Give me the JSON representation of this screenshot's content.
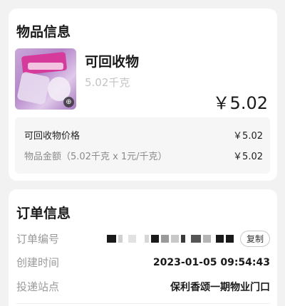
{
  "goods": {
    "title": "物品信息",
    "item_name": "可回收物",
    "item_weight": "5.02千克",
    "item_price": "￥5.02",
    "summary": [
      {
        "label": "可回收物价格",
        "value": "￥5.02"
      },
      {
        "label": "物品金额（5.02千克 x 1元/千克）",
        "value": "￥5.02"
      }
    ]
  },
  "order": {
    "title": "订单信息",
    "order_no_label": "订单编号",
    "copy_label": "复制",
    "created_label": "创建时间",
    "created_value": "2023-01-05 09:54:43",
    "station_label": "投递站点",
    "station_value": "保利香颂一期物业门口"
  },
  "icons": {
    "zoom": "zoom-icon"
  },
  "colors": {
    "page_bg": "#f2f2f2",
    "card_bg": "#ffffff",
    "muted_text": "#9a9a9a"
  }
}
